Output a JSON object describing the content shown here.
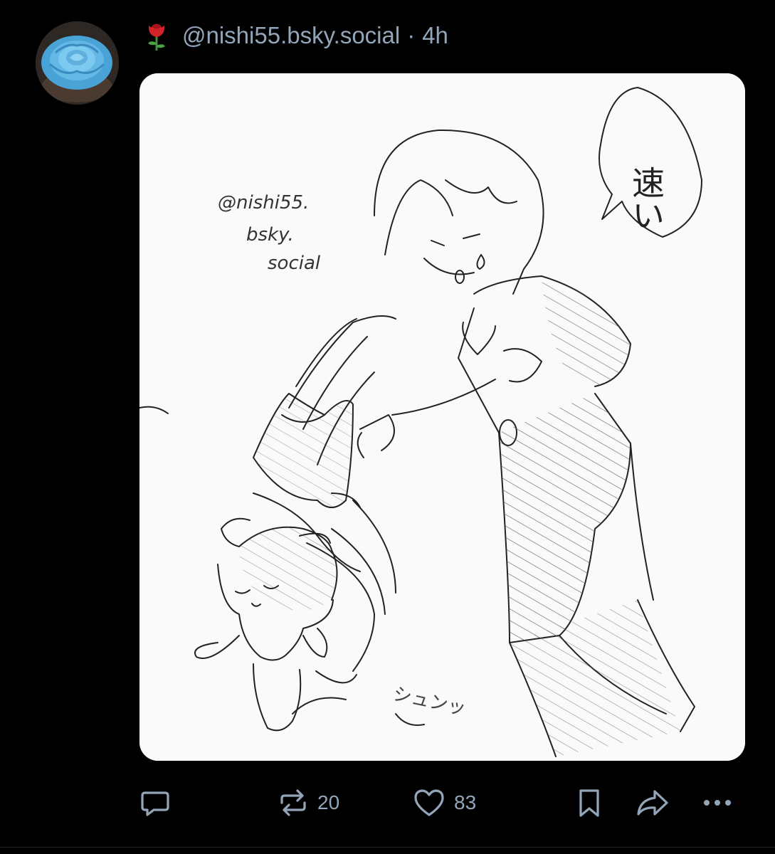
{
  "post": {
    "handle": "@nishi55.bsky.social",
    "separator": "·",
    "time": "4h",
    "emoji_icon": "rose-icon",
    "avatar": "blue-rose-cupcake-avatar"
  },
  "image": {
    "speech_text": "速い",
    "watermark_line1": "@nishi55.",
    "watermark_line2": "bsky.",
    "watermark_line3": "social",
    "sfx_text": "シュンッ"
  },
  "actions": {
    "reply_icon": "reply-icon",
    "repost_icon": "repost-icon",
    "repost_count": "20",
    "like_icon": "heart-icon",
    "like_count": "83",
    "bookmark_icon": "bookmark-icon",
    "share_icon": "share-icon",
    "more_icon": "more-icon"
  },
  "colors": {
    "background": "#000000",
    "text_muted": "#93a5b8",
    "card": "#fafafa"
  }
}
